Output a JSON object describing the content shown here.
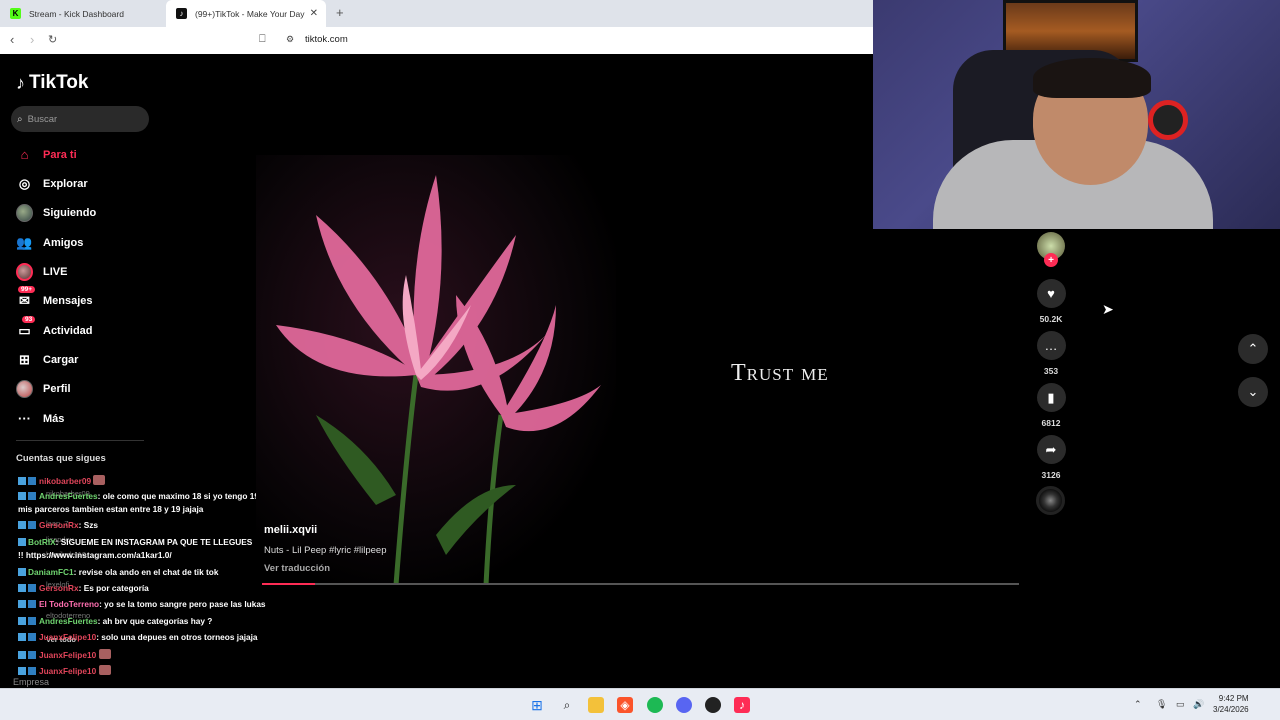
{
  "browser": {
    "tabs": [
      {
        "title": "Stream - Kick Dashboard",
        "favicon": "K"
      },
      {
        "title": "(99+)TikTok - Make Your Day",
        "favicon": "♪"
      }
    ],
    "url": "tiktok.com"
  },
  "sidebar": {
    "brand": "TikTok",
    "search_placeholder": "Buscar",
    "nav": [
      {
        "label": "Para ti"
      },
      {
        "label": "Explorar"
      },
      {
        "label": "Siguiendo"
      },
      {
        "label": "Amigos"
      },
      {
        "label": "LIVE"
      },
      {
        "label": "Mensajes",
        "badge": "99+"
      },
      {
        "label": "Actividad",
        "badge": "93"
      },
      {
        "label": "Cargar"
      },
      {
        "label": "Perfil"
      },
      {
        "label": "Más"
      }
    ],
    "following_title": "Cuentas que sigues",
    "footer": "Empresa"
  },
  "chat": [
    {
      "user": "nikobarber09",
      "text": ""
    },
    {
      "user": "AndresFuertes",
      "text": ": ole como que maximo 18 si yo tengo 19 y"
    },
    {
      "user": "",
      "text": "mis parceros tambien estan entre 18 y 19 jajaja"
    },
    {
      "user": "GersonRx",
      "text": ": Szs"
    },
    {
      "user": "BotRIX",
      "text": ": SIGUEME EN INSTAGRAM PA QUE TE LLEGUES"
    },
    {
      "user": "",
      "text": "!! https://www.instagram.com/a1kar1.0/"
    },
    {
      "user": "DaniamFC1",
      "text": ": revise ola ando en el chat de tik tok"
    },
    {
      "user": "GersonRx",
      "text": ": Es por categoría"
    },
    {
      "user": "El TodoTerreno",
      "text": ": yo se la tomo sangre pero pase las lukas"
    },
    {
      "user": "AndresFuertes",
      "text": ": ah brv que categorías hay ?"
    },
    {
      "user": "JuanxFelipe10",
      "text": ": solo una depues en otros torneos jajaja"
    },
    {
      "user": "JuanxFelipe10",
      "text": ""
    },
    {
      "user": "JuanxFelipe10",
      "text": ""
    }
  ],
  "following_ghosts": [
    "nikobarber09",
    "laap_7",
    "lisapdev",
    "barrileder10",
    "lexelofi",
    "eltodoterreno",
    "Ver todo"
  ],
  "video": {
    "overlay_text": "Trust me",
    "author": "melii.xqvii",
    "description": "Nuts - Lil Peep #lyric #lilpeep",
    "translate": "Ver traducción",
    "progress": 0.07
  },
  "actions": {
    "likes": "50.2K",
    "comments": "353",
    "saves": "6812",
    "shares": "3126"
  },
  "taskbar": {
    "time": "9:42 PM",
    "date": "3/24/2026"
  },
  "colors": {
    "accent": "#fe2c55",
    "background": "#000000"
  }
}
